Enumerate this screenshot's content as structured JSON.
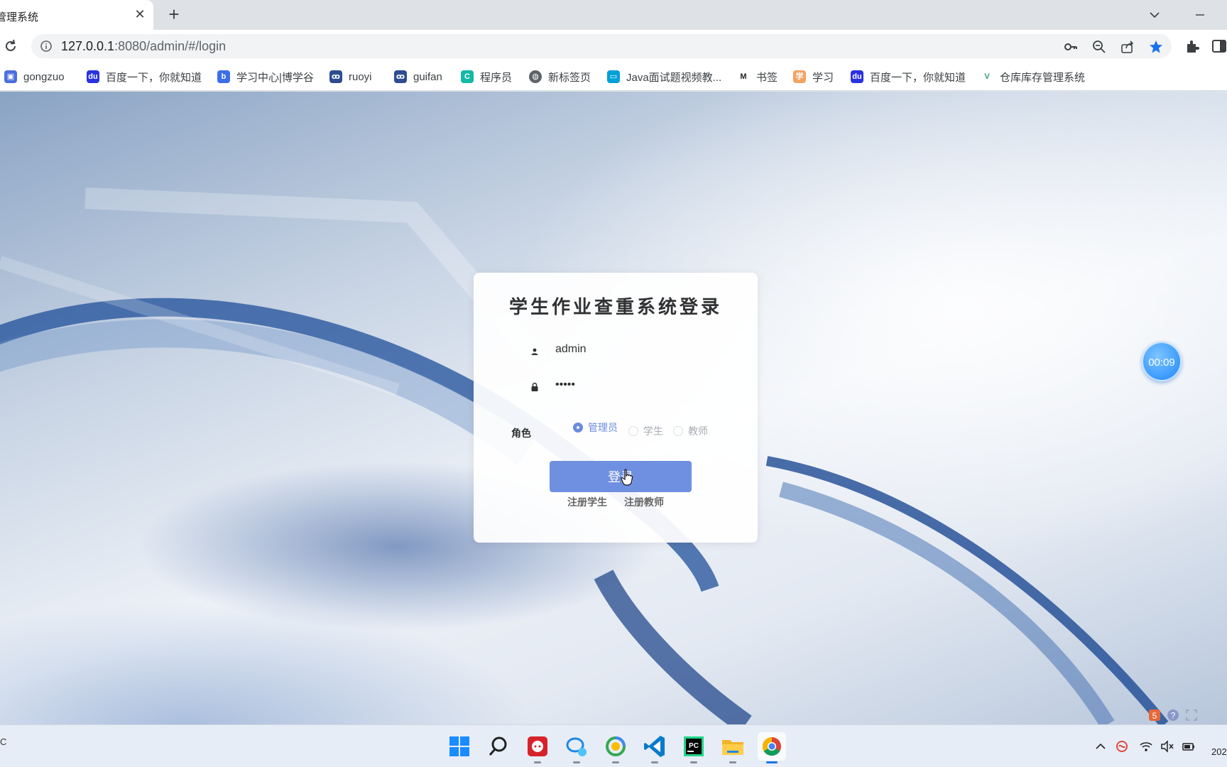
{
  "browser": {
    "tab_title": "管理系统",
    "tab_close": "✕",
    "new_tab": "+",
    "url_host": "127.0.0.1",
    "url_rest": ":8080/admin/#/login"
  },
  "bookmarks": [
    {
      "label": "gongzuo",
      "icon": "folder-bookmark-icon"
    },
    {
      "label": "百度一下，你就知道",
      "icon": "baidu-icon"
    },
    {
      "label": "学习中心|博学谷",
      "icon": "boxuegu-icon"
    },
    {
      "label": "ruoyi",
      "icon": "ruoyi-icon"
    },
    {
      "label": "guifan",
      "icon": "ruoyi-icon"
    },
    {
      "label": "程序员",
      "icon": "c-icon"
    },
    {
      "label": "新标签页",
      "icon": "globe-icon"
    },
    {
      "label": "Java面试题视频教...",
      "icon": "bilibili-icon"
    },
    {
      "label": "书签",
      "icon": "m-icon"
    },
    {
      "label": "学习",
      "icon": "study-icon"
    },
    {
      "label": "百度一下，你就知道",
      "icon": "baidu-icon"
    },
    {
      "label": "仓库库存管理系统",
      "icon": "vue-icon"
    }
  ],
  "login": {
    "title": "学生作业查重系统登录",
    "username_value": "admin",
    "password_value": "12345",
    "role_label": "角色",
    "roles": [
      {
        "label": "管理员",
        "checked": true
      },
      {
        "label": "学生",
        "checked": false
      },
      {
        "label": "教师",
        "checked": false
      }
    ],
    "submit_label": "登录",
    "register_student": "注册学生",
    "register_teacher": "注册教师"
  },
  "timer": "00:09",
  "taskbar": {
    "clock": "202",
    "left_edge": "C"
  },
  "colors": {
    "accent": "#6f8fe0",
    "timer": "#1e88ff",
    "bookmark_star": "#1a73e8"
  }
}
